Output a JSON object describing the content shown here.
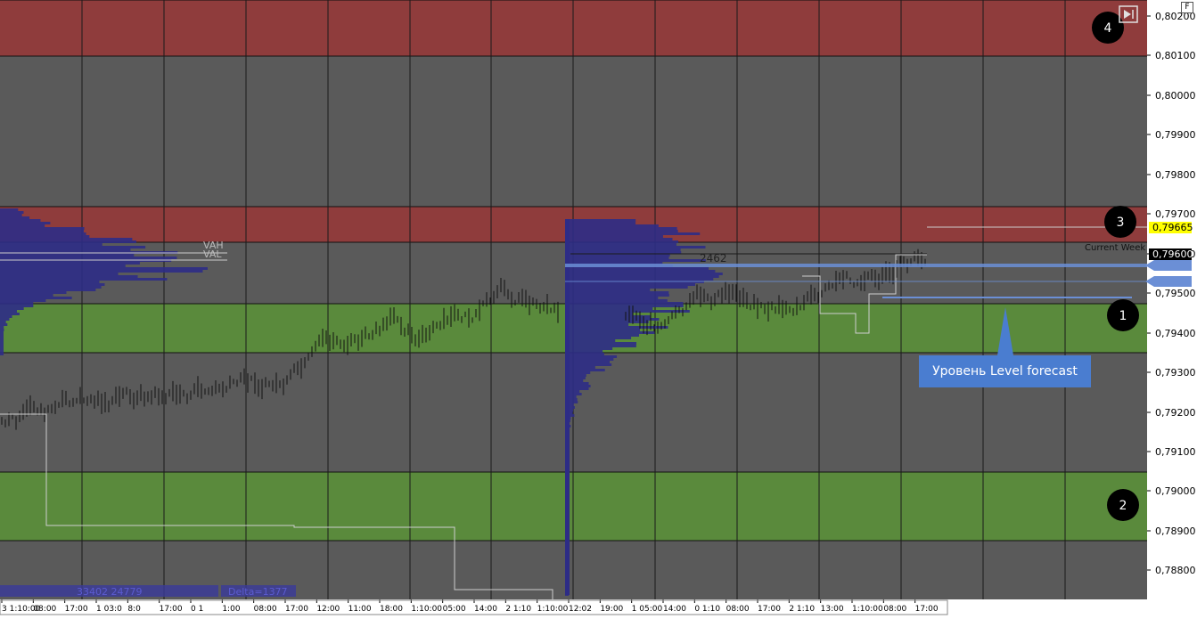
{
  "toolbar": {
    "f_button": "F",
    "end_button_icon": "scroll-to-end-icon"
  },
  "price_axis": {
    "labels": [
      "0,80200",
      "0,80100",
      "0,80000",
      "0,79900",
      "0,79800",
      "0,79700",
      "0,79600",
      "0,79500",
      "0,79400",
      "0,79300",
      "0,79200",
      "0,79100",
      "0,79000",
      "0,78900",
      "0,78800"
    ],
    "current_price": "0,79665",
    "current_week_price": "0,79600"
  },
  "zones": [
    {
      "id": "4",
      "label": "4",
      "type": "resistance",
      "color": "#8f3c3c"
    },
    {
      "id": "3",
      "label": "3",
      "type": "resistance",
      "color": "#8f3c3c"
    },
    {
      "id": "1",
      "label": "1",
      "type": "support",
      "color": "#5a8a3c"
    },
    {
      "id": "2",
      "label": "2",
      "type": "support",
      "color": "#5a8a3c"
    }
  ],
  "annotations": {
    "vah": "VAH",
    "val": "VAL",
    "volume_value": "2462",
    "current_week": "Current Week",
    "delta_left": "33402 24779",
    "delta_right": "Delta=1377",
    "forecast_callout": "Уровень Level forecast"
  },
  "time_axis": {
    "labels": [
      "3 1:10:00",
      "08:00",
      "17:00",
      "1 03:0",
      "8:0",
      "17:00",
      "0 1",
      "1:00",
      "08:00",
      "17:00",
      "12:00",
      "11:00",
      "18:00",
      "1:10:00",
      "05:00",
      "14:00",
      "2 1:10",
      "1:10:00",
      "12:02",
      "19:00",
      "1 05:00",
      "14:00",
      "0 1:10",
      "08:00",
      "17:00",
      "2 1:10",
      "13:00",
      "1:10:00",
      "08:00",
      "17:00"
    ]
  },
  "colors": {
    "background": "#5a5a5a",
    "resistance_zone": "#8f3c3c",
    "support_zone": "#5a8a3c",
    "volume_profile": "#2e2c86",
    "level_line": "#6b8fd6",
    "current_price_badge": "#ffff00"
  }
}
